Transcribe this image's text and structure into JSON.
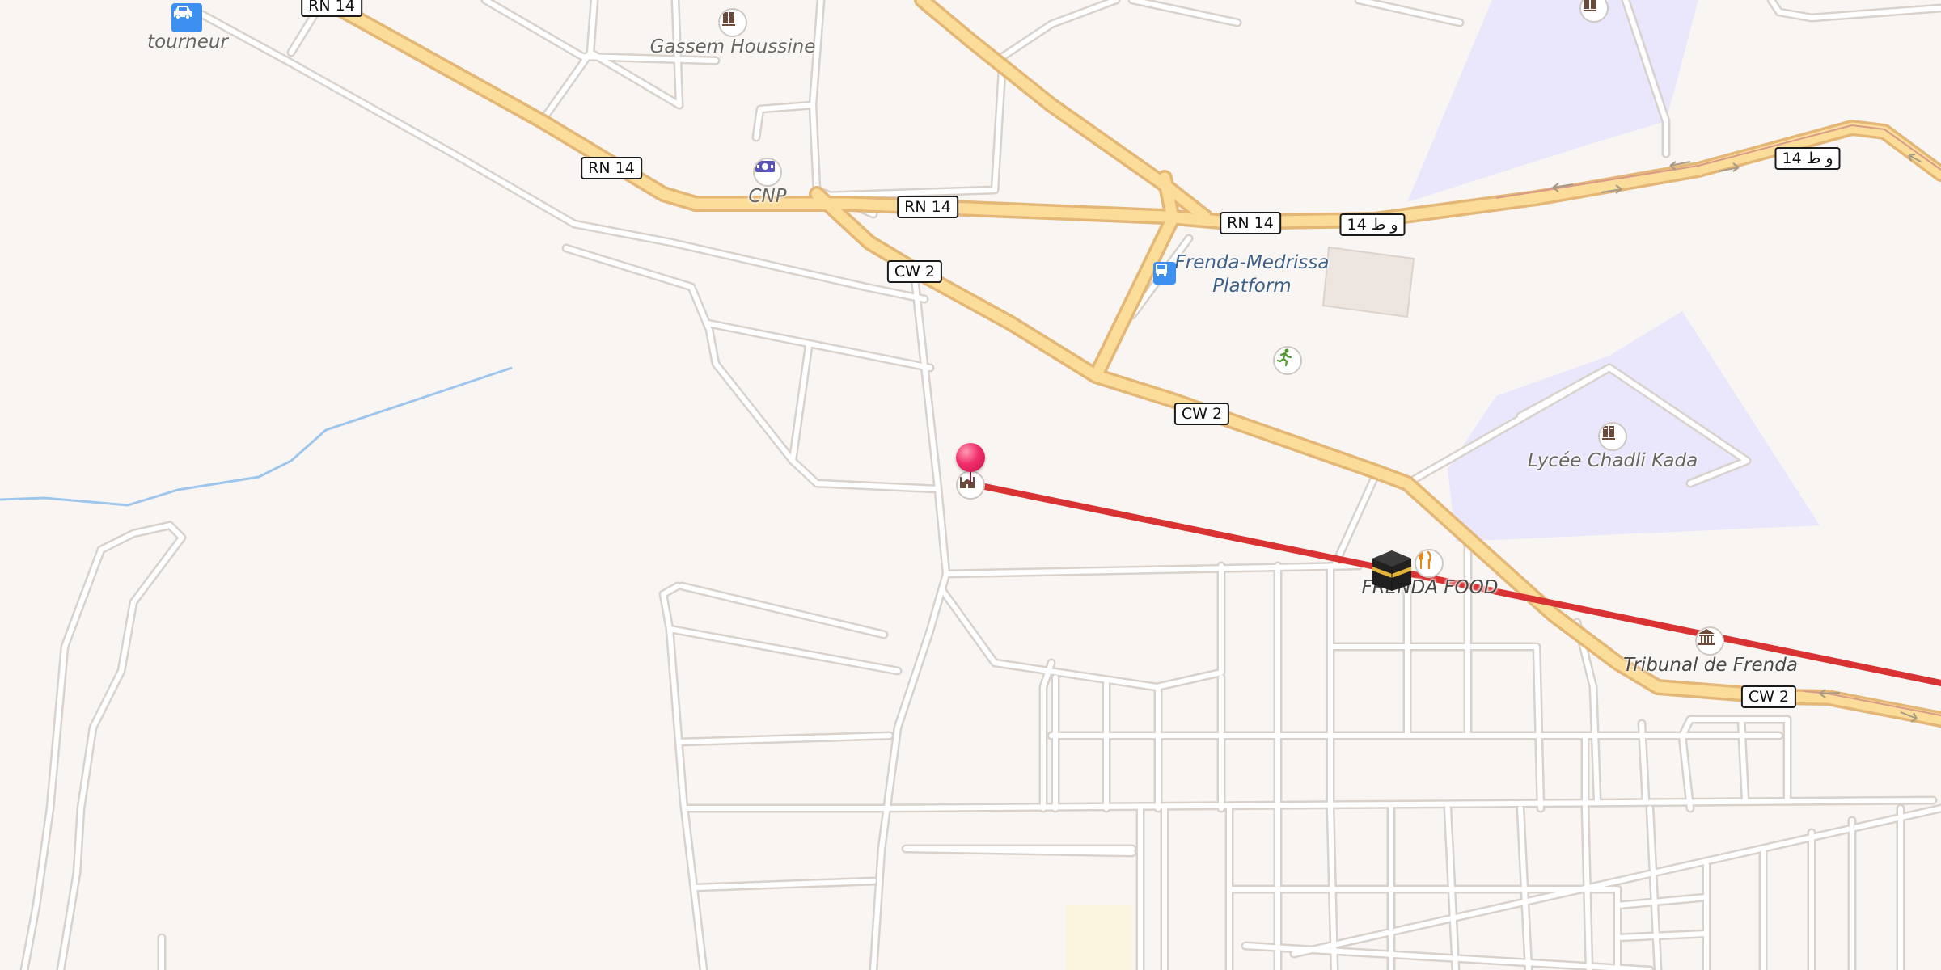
{
  "map": {
    "colors": {
      "background": "#f8f5f2",
      "minor_road": "#ffffff",
      "major_road": "#fbdd99",
      "major_road_casing": "#e4b776",
      "school_area": "#eae6fb",
      "water": "#9cc6ec",
      "route_line": "#d93232",
      "pin": "#ef2f6a"
    },
    "labels": {
      "tourneur": "tourneur",
      "gassem": "Gassem Houssine",
      "cnp": "CNP",
      "platform": [
        "Frenda-Medrissa",
        "Platform"
      ],
      "lycee": "Lycée Chadli Kada",
      "frenda_food": "FRENDA FOOD",
      "tribunal": "Tribunal de Frenda"
    },
    "shields": {
      "rn14_top": "RN 14",
      "rn14_a": "RN 14",
      "rn14_b": "RN 14",
      "rn14_c": "RN 14",
      "ar14_a": "14 و ط",
      "ar14_b": "14 و ط",
      "cw2_a": "CW 2",
      "cw2_b": "CW 2",
      "cw2_c": "CW 2"
    },
    "icons": {
      "car": "car-icon",
      "bus": "bus-icon",
      "money": "money-icon",
      "school": "school-icon",
      "mosque": "mosque-icon",
      "sport": "running-icon",
      "restaurant": "fork-knife-icon",
      "courthouse": "courthouse-icon",
      "kaaba": "kaaba-icon",
      "pin": "location-pin-icon"
    }
  }
}
